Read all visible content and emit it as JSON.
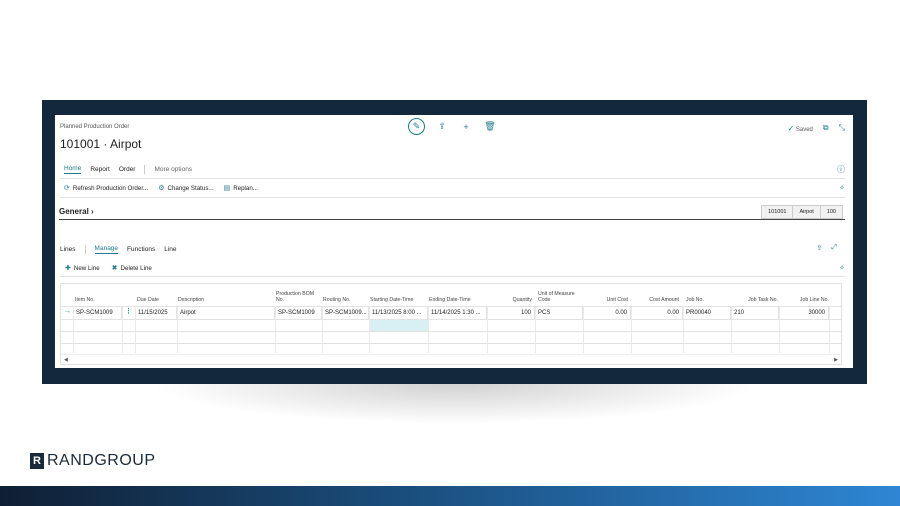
{
  "page": {
    "breadcrumb": "Planned Production Order",
    "title": "101001 · Airpot",
    "status": "Saved"
  },
  "tabs": [
    {
      "label": "Home"
    },
    {
      "label": "Report"
    },
    {
      "label": "Order"
    },
    {
      "label": "More options"
    }
  ],
  "actions": [
    {
      "label": "Refresh Production Order...",
      "icon": "refresh-icon"
    },
    {
      "label": "Change Status...",
      "icon": "change-status-icon"
    },
    {
      "label": "Replan...",
      "icon": "replan-icon"
    }
  ],
  "general": {
    "label": "General",
    "summary": [
      "101001",
      "Airpot",
      "100"
    ]
  },
  "lines": {
    "label": "Lines",
    "tabs": [
      "Manage",
      "Functions",
      "Line"
    ],
    "actions": [
      {
        "label": "New Line",
        "icon": "new-line-icon"
      },
      {
        "label": "Delete Line",
        "icon": "delete-line-icon"
      }
    ],
    "columns": [
      "Item No.",
      "Due Date",
      "Description",
      "Production BOM No.",
      "Routing No.",
      "Starting Date-Time",
      "Ending Date-Time",
      "Quantity",
      "Unit of Measure Code",
      "Unit Cost",
      "Cost Amount",
      "Job No.",
      "Job Task No.",
      "Job Line No."
    ],
    "row": {
      "item_no": "SP-SCM1009",
      "due_date": "11/15/2025",
      "description": "Airpot",
      "bom_no": "SP-SCM1009",
      "routing_no": "SP-SCM1009...",
      "starting": "11/13/2025 8:00 ...",
      "ending": "11/14/2025 1:30 ...",
      "quantity": "100",
      "uom": "PCS",
      "unit_cost": "0.00",
      "cost_amount": "0.00",
      "job_no": "PR00040",
      "job_task_no": "210",
      "job_line_no": "30000"
    }
  },
  "logo": {
    "text": "RANDGROUP",
    "mark": "R"
  },
  "colors": {
    "accent": "#1c7b8c",
    "frame": "#14283d"
  }
}
